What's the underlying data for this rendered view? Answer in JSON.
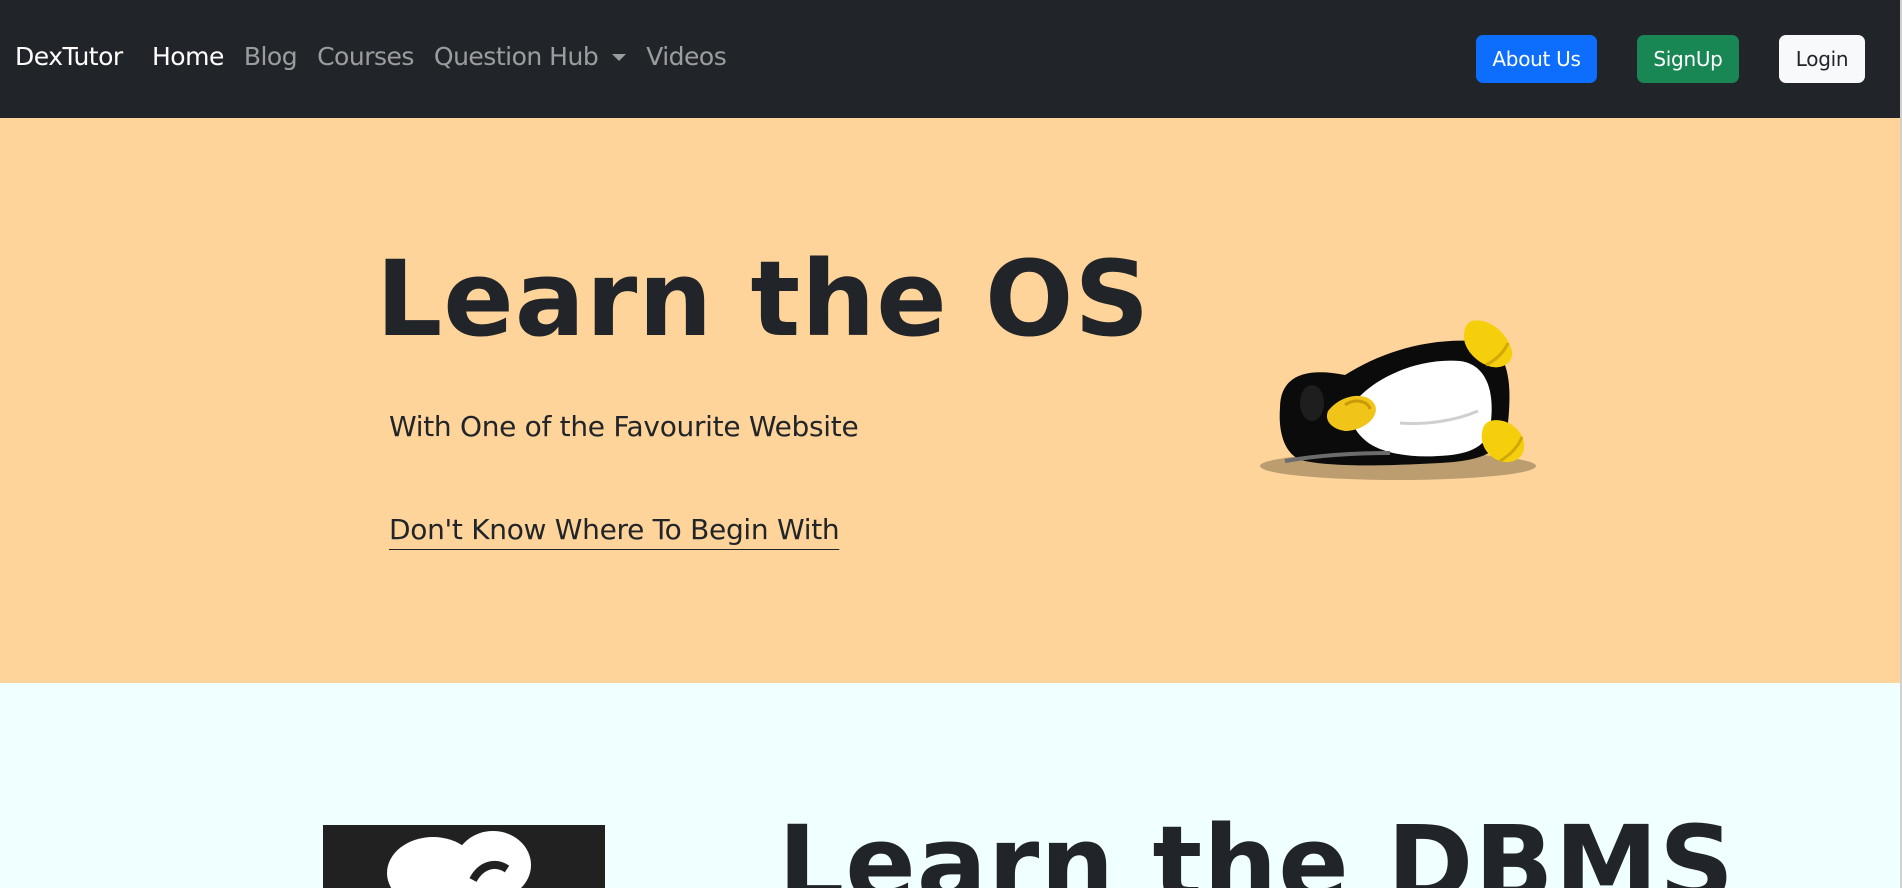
{
  "navbar": {
    "brand": "DexTutor",
    "links": [
      {
        "label": "Home",
        "active": true
      },
      {
        "label": "Blog",
        "active": false
      },
      {
        "label": "Courses",
        "active": false
      },
      {
        "label": "Question Hub",
        "active": false,
        "dropdown": true
      },
      {
        "label": "Videos",
        "active": false
      }
    ],
    "buttons": {
      "about": "About Us",
      "signup": "SignUp",
      "login": "Login"
    }
  },
  "os_section": {
    "title": "Learn the OS",
    "subtitle": "With One of the Favourite Website",
    "link": "Don't Know Where To Begin With",
    "image_icon": "tux-penguin-icon"
  },
  "dbms_section": {
    "title": "Learn the DBMS",
    "image_icon": "dbms-logo-icon"
  },
  "colors": {
    "navbar_bg": "#212529",
    "os_bg": "#fed49a",
    "dbms_bg": "#f0ffff",
    "about_btn": "#0d6efd",
    "signup_btn": "#198754",
    "login_btn": "#f8f9fa"
  }
}
